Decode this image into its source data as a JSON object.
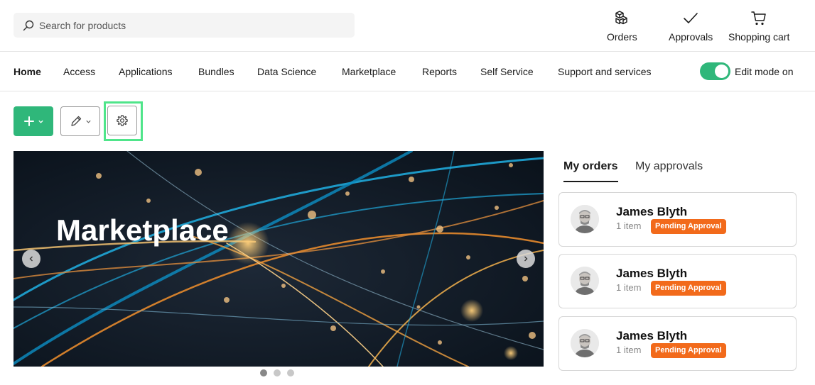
{
  "search": {
    "placeholder": "Search for products"
  },
  "header": {
    "orders_label": "Orders",
    "approvals_label": "Approvals",
    "cart_label": "Shopping cart"
  },
  "nav": {
    "items": [
      {
        "label": "Home",
        "active": true
      },
      {
        "label": "Access"
      },
      {
        "label": "Applications"
      },
      {
        "label": "Bundles"
      },
      {
        "label": "Data Science"
      },
      {
        "label": "Marketplace"
      },
      {
        "label": "Reports"
      },
      {
        "label": "Self Service"
      },
      {
        "label": "Support and services"
      }
    ],
    "edit_mode_label": "Edit mode on",
    "edit_mode_on": true
  },
  "toolbar": {
    "add_icon": "plus-icon",
    "edit_icon": "pencil-icon",
    "settings_icon": "gear-icon"
  },
  "carousel": {
    "title": "Marketplace",
    "slide_count": 3,
    "active_slide": 0
  },
  "orders_panel": {
    "tabs": [
      {
        "label": "My orders",
        "active": true
      },
      {
        "label": "My approvals"
      }
    ],
    "orders": [
      {
        "name": "James Blyth",
        "items": "1 item",
        "status": "Pending Approval"
      },
      {
        "name": "James Blyth",
        "items": "1 item",
        "status": "Pending Approval"
      },
      {
        "name": "James Blyth",
        "items": "1 item",
        "status": "Pending Approval"
      }
    ]
  },
  "colors": {
    "accent_green": "#2fb77a",
    "badge_orange": "#f26a1b",
    "highlight": "#4fe58a"
  }
}
